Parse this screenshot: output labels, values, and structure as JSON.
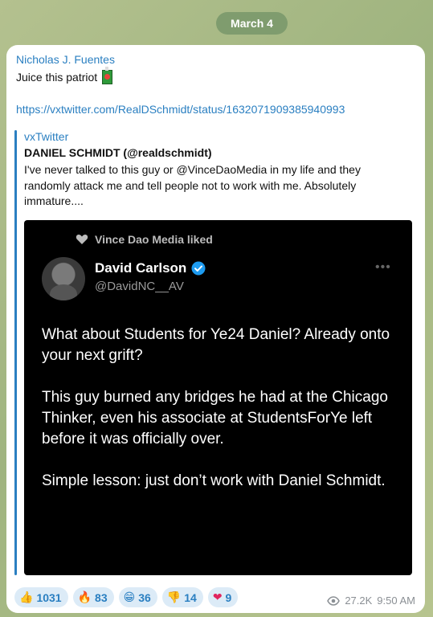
{
  "date_divider": "March 4",
  "message": {
    "sender": "Nicholas J. Fuentes",
    "text": "Juice this patriot",
    "emoji_icon": "juice-box-icon",
    "link": "https://vxtwitter.com/RealDSchmidt/status/1632071909385940993",
    "preview": {
      "site_name": "vxTwitter",
      "title": "DANIEL SCHMIDT (@realdschmidt)",
      "description": "I've never talked to this guy or @VinceDaoMedia in my life and they randomly attack me and tell people not to work with me. Absolutely immature....",
      "tweet": {
        "liked_by": "Vince Dao Media liked",
        "author_name": "David Carlson",
        "author_handle": "@DavidNC__AV",
        "paragraphs": [
          "What about Students for Ye24 Daniel? Already onto your next grift?",
          "This guy burned any bridges he had at the Chicago Thinker, even his associate at StudentsForYe left before it was officially over.",
          "Simple lesson: just don’t work with Daniel Schmidt."
        ]
      }
    },
    "reactions": [
      {
        "emoji": "👍",
        "count": "1031"
      },
      {
        "emoji": "🔥",
        "count": "83"
      },
      {
        "emoji": "😁",
        "count": "36"
      },
      {
        "emoji": "👎",
        "count": "14"
      },
      {
        "emoji": "❤",
        "count": "9"
      }
    ],
    "views": "27.2K",
    "time": "9:50 AM"
  },
  "colors": {
    "link": "#2a7fc1",
    "date_pill": "#7f9c6e",
    "reaction_bg": "#dcebf7"
  }
}
